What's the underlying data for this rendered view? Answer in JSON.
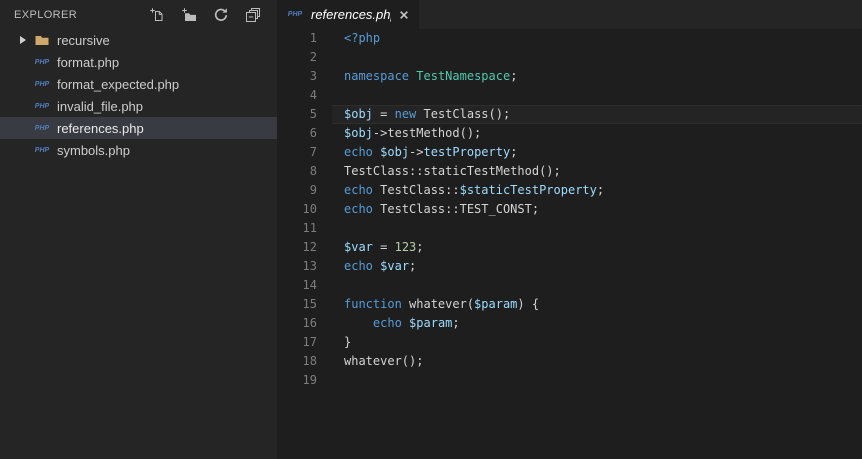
{
  "colors": {
    "editor_bg": "#1e1e1e",
    "sidebar_bg": "#252526",
    "tabbar_bg": "#252526",
    "selected_item_bg": "#383b41",
    "icon_gray": "#c5c5c5",
    "php_icon": "#4e7dbd",
    "folder_icon": "#cfa96b",
    "line_number": "#7d7d7d",
    "keyword": "#569cd6",
    "type": "#4ec9b0",
    "variable": "#9cdcfe",
    "number": "#b5cea8",
    "text": "#d4d4d4"
  },
  "sidebar": {
    "title": "EXPLORER",
    "php_icon_text": "PHP",
    "actions": [
      {
        "icon": "new-file-icon"
      },
      {
        "icon": "new-folder-icon"
      },
      {
        "icon": "refresh-icon"
      },
      {
        "icon": "collapse-all-icon"
      }
    ],
    "items": [
      {
        "type": "folder",
        "label": "recursive",
        "selected": false,
        "expanded": false
      },
      {
        "type": "php-file",
        "label": "format.php",
        "selected": false
      },
      {
        "type": "php-file",
        "label": "format_expected.php",
        "selected": false
      },
      {
        "type": "php-file",
        "label": "invalid_file.php",
        "selected": false
      },
      {
        "type": "php-file",
        "label": "references.php",
        "selected": true
      },
      {
        "type": "php-file",
        "label": "symbols.php",
        "selected": false
      }
    ]
  },
  "tabs": [
    {
      "label": "references.php",
      "file_icon_text": "PHP",
      "active": true,
      "preview": true,
      "close_icon": "close-icon"
    }
  ],
  "editor": {
    "language": "php",
    "current_line": 5,
    "lines": [
      {
        "num": 1,
        "tokens": [
          {
            "t": "<?php",
            "c": "k"
          }
        ]
      },
      {
        "num": 2,
        "tokens": []
      },
      {
        "num": 3,
        "tokens": [
          {
            "t": "namespace",
            "c": "k"
          },
          {
            "t": " ",
            "c": "d"
          },
          {
            "t": "TestNamespace",
            "c": "t"
          },
          {
            "t": ";",
            "c": "d"
          }
        ]
      },
      {
        "num": 4,
        "tokens": []
      },
      {
        "num": 5,
        "tokens": [
          {
            "t": "$obj",
            "c": "v"
          },
          {
            "t": " = ",
            "c": "d"
          },
          {
            "t": "new",
            "c": "k"
          },
          {
            "t": " TestClass();",
            "c": "d"
          }
        ]
      },
      {
        "num": 6,
        "tokens": [
          {
            "t": "$obj",
            "c": "v"
          },
          {
            "t": "->testMethod();",
            "c": "d"
          }
        ]
      },
      {
        "num": 7,
        "tokens": [
          {
            "t": "echo",
            "c": "k"
          },
          {
            "t": " ",
            "c": "d"
          },
          {
            "t": "$obj",
            "c": "v"
          },
          {
            "t": "->",
            "c": "d"
          },
          {
            "t": "testProperty",
            "c": "v"
          },
          {
            "t": ";",
            "c": "d"
          }
        ]
      },
      {
        "num": 8,
        "tokens": [
          {
            "t": "TestClass::staticTestMethod();",
            "c": "d"
          }
        ]
      },
      {
        "num": 9,
        "tokens": [
          {
            "t": "echo",
            "c": "k"
          },
          {
            "t": " TestClass::",
            "c": "d"
          },
          {
            "t": "$staticTestProperty",
            "c": "v"
          },
          {
            "t": ";",
            "c": "d"
          }
        ]
      },
      {
        "num": 10,
        "tokens": [
          {
            "t": "echo",
            "c": "k"
          },
          {
            "t": " TestClass::TEST_CONST;",
            "c": "d"
          }
        ]
      },
      {
        "num": 11,
        "tokens": []
      },
      {
        "num": 12,
        "tokens": [
          {
            "t": "$var",
            "c": "v"
          },
          {
            "t": " = ",
            "c": "d"
          },
          {
            "t": "123",
            "c": "n"
          },
          {
            "t": ";",
            "c": "d"
          }
        ]
      },
      {
        "num": 13,
        "tokens": [
          {
            "t": "echo",
            "c": "k"
          },
          {
            "t": " ",
            "c": "d"
          },
          {
            "t": "$var",
            "c": "v"
          },
          {
            "t": ";",
            "c": "d"
          }
        ]
      },
      {
        "num": 14,
        "tokens": []
      },
      {
        "num": 15,
        "tokens": [
          {
            "t": "function",
            "c": "k"
          },
          {
            "t": " whatever(",
            "c": "d"
          },
          {
            "t": "$param",
            "c": "v"
          },
          {
            "t": ") {",
            "c": "d"
          }
        ]
      },
      {
        "num": 16,
        "tokens": [
          {
            "t": "    ",
            "c": "d"
          },
          {
            "t": "echo",
            "c": "k"
          },
          {
            "t": " ",
            "c": "d"
          },
          {
            "t": "$param",
            "c": "v"
          },
          {
            "t": ";",
            "c": "d"
          }
        ]
      },
      {
        "num": 17,
        "tokens": [
          {
            "t": "}",
            "c": "d"
          }
        ]
      },
      {
        "num": 18,
        "tokens": [
          {
            "t": "whatever();",
            "c": "d"
          }
        ]
      },
      {
        "num": 19,
        "tokens": []
      }
    ]
  }
}
